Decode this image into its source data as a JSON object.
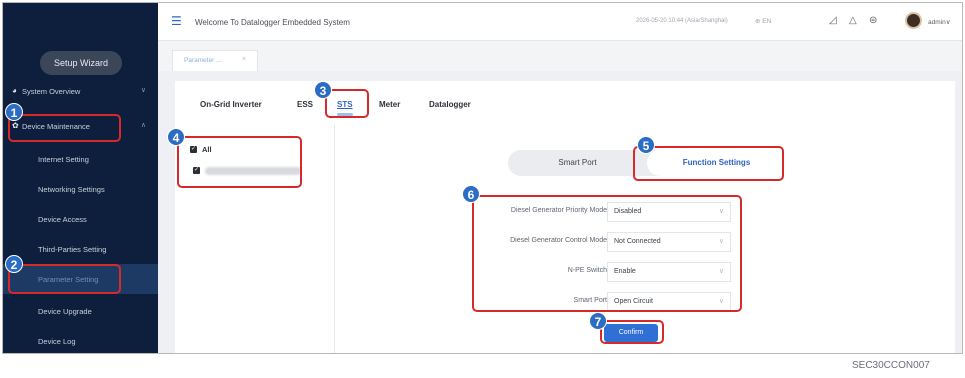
{
  "sidebar": {
    "wizard_label": "Setup Wizard",
    "items": [
      {
        "label": "System Overview",
        "icon": "pie-chart-icon"
      },
      {
        "label": "Device Maintenance",
        "icon": "gear-icon"
      },
      {
        "label": "Internet Setting"
      },
      {
        "label": "Networking Settings"
      },
      {
        "label": "Device Access"
      },
      {
        "label": "Third-Parties Setting"
      },
      {
        "label": "Parameter Setting"
      },
      {
        "label": "Device Upgrade"
      },
      {
        "label": "Device Log"
      }
    ]
  },
  "header": {
    "title": "Welcome To Datalogger Embedded System",
    "datetime": "2026-05-20 10:44 (Asia/Shanghai)",
    "language": "EN",
    "user": "admin"
  },
  "tabstrip": {
    "page_tab_label": "Parameter ...",
    "close_glyph": "×"
  },
  "nav_tabs": [
    "On-Grid Inverter",
    "ESS",
    "STS",
    "Meter",
    "Datalogger"
  ],
  "tree": {
    "all_label": "All"
  },
  "segmented": {
    "options": [
      "Smart Port",
      "Function Settings"
    ],
    "selected": "Function Settings"
  },
  "form": {
    "fields": [
      {
        "label": "Diesel Generator Priority Mode",
        "value": "Disabled"
      },
      {
        "label": "Diesel Generator Control Mode",
        "value": "Not Connected"
      },
      {
        "label": "N-PE Switch",
        "value": "Enable"
      },
      {
        "label": "Smart Port",
        "value": "Open Circuit"
      }
    ]
  },
  "confirm_label": "Confirm",
  "callouts": [
    "1",
    "2",
    "3",
    "4",
    "5",
    "6",
    "7"
  ],
  "caption": "SEC30CCON007",
  "colors": {
    "sidebar_bg": "#0d1f3c",
    "accent": "#2f63bf",
    "callout_red": "#d62a2a",
    "callout_badge": "#2b6cc4"
  }
}
